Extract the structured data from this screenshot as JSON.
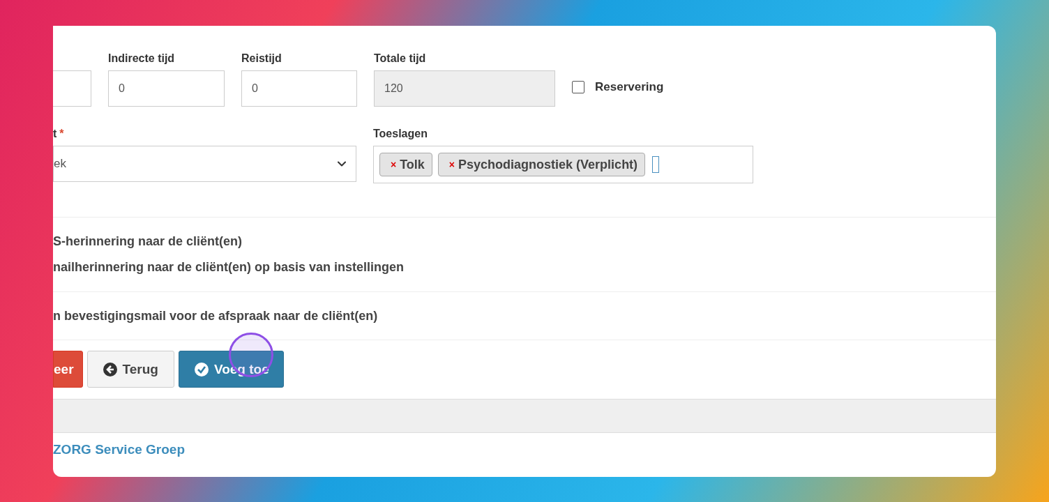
{
  "time_fields": [
    {
      "kind": "cut"
    },
    {
      "label": "Indirecte tijd",
      "value": "0",
      "kind": "input"
    },
    {
      "label": "Reistijd",
      "value": "0",
      "kind": "input"
    },
    {
      "label": "Totale tijd",
      "value": "120",
      "kind": "readonly"
    }
  ],
  "reservering": {
    "label": "Reservering",
    "checked": false
  },
  "select_field": {
    "label": "t",
    "required_mark": "*",
    "value": "ek"
  },
  "toeslagen": {
    "label": "Toeslagen",
    "tags": [
      "Tolk",
      "Psychodiagnostiek (Verplicht)"
    ],
    "remove_mark": "×"
  },
  "reminder_options": [
    "S-herinnering naar de cliënt(en)",
    "nailherinnering naar de cliënt(en) op basis van instellingen"
  ],
  "confirmation_option": "n bevestigingsmail voor de afspraak naar de cliënt(en)",
  "buttons": [
    {
      "label": "eer",
      "kind": "danger"
    },
    {
      "label": "Terug",
      "kind": "back"
    },
    {
      "label": "Voeg toe",
      "kind": "primary"
    }
  ],
  "footer": "ZORG Service Groep"
}
